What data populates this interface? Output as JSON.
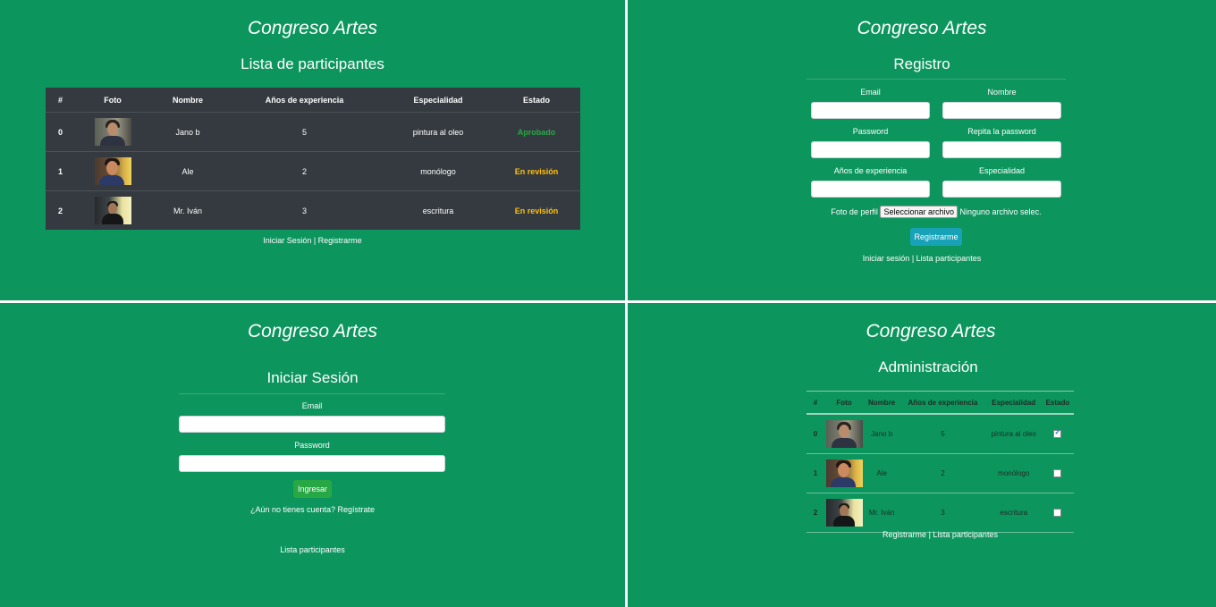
{
  "brand": "Congreso Artes",
  "participants": [
    {
      "idx": "0",
      "name": "Jano b",
      "years": "5",
      "specialty": "pintura al oleo",
      "status": "Aprobado",
      "approved": true
    },
    {
      "idx": "1",
      "name": "Ale",
      "years": "2",
      "specialty": "monólogo",
      "status": "En revisión",
      "approved": false
    },
    {
      "idx": "2",
      "name": "Mr. Iván",
      "years": "3",
      "specialty": "escritura",
      "status": "En revisión",
      "approved": false
    }
  ],
  "list_page": {
    "title": "Lista de participantes",
    "columns": [
      "#",
      "Foto",
      "Nombre",
      "Años de experiencia",
      "Especialidad",
      "Estado"
    ],
    "link_login": "Iniciar Sesión",
    "separator": " | ",
    "link_register": "Registrarme"
  },
  "register_page": {
    "title": "Registro",
    "email_label": "Email",
    "name_label": "Nombre",
    "password_label": "Password",
    "repeat_password_label": "Repita la password",
    "years_label": "Años de experiencia",
    "specialty_label": "Especialidad",
    "photo_label": "Foto de perfil",
    "file_button": "Seleccionar archivo",
    "file_status": "Ninguno archivo selec.",
    "submit": "Registrarme",
    "link_login": "Iniciar sesión",
    "separator": " | ",
    "link_list": "Lista participantes"
  },
  "login_page": {
    "title": "Iniciar Sesión",
    "email_label": "Email",
    "password_label": "Password",
    "submit": "Ingresar",
    "no_account_link": "¿Aún no tienes cuenta? Regístrate",
    "link_list": "Lista participantes"
  },
  "admin_page": {
    "title": "Administración",
    "columns": [
      "#",
      "Foto",
      "Nombre",
      "Años de experiencia",
      "Especialidad",
      "Estado"
    ],
    "link_register": "Registrarme",
    "separator": " | ",
    "link_list": "Lista participantes"
  },
  "colors": {
    "background": "#0d955e",
    "table_dark": "#343a40",
    "approved": "#28a745",
    "in_review": "#ffc107",
    "button_info": "#17a2b8",
    "button_success": "#28a745"
  }
}
